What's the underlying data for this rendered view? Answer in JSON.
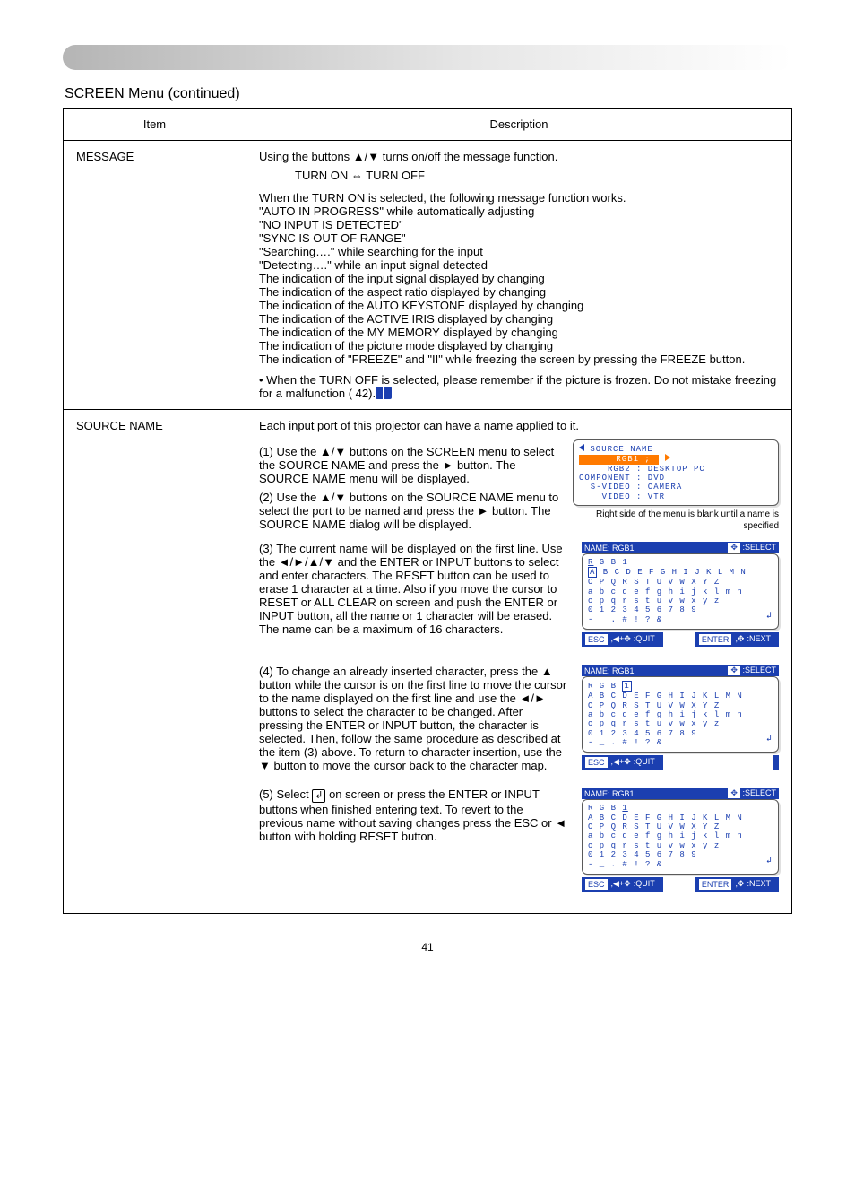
{
  "page": {
    "number": "41",
    "section_title": "SCREEN Menu (continued)"
  },
  "table": {
    "header": {
      "item": "Item",
      "desc": "Description"
    },
    "rows": [
      {
        "item": "MESSAGE",
        "desc": {
          "intro": "Using the buttons ▲/▼ turns on/off the message function.",
          "toggle_line_prefix": "TURN ON ",
          "toggle_line_suffix": " TURN OFF",
          "on_intro": "When the TURN ON is selected, the following message function works.",
          "bullets": [
            "\"AUTO IN PROGRESS\" while automatically adjusting",
            "\"NO INPUT IS DETECTED\"",
            "\"SYNC IS OUT OF RANGE\"",
            "\"Searching….\" while searching for the input",
            "\"Detecting….\" while an input signal detected",
            "The indication of the input signal displayed by changing",
            "The indication of the aspect ratio displayed by changing",
            "The indication of the AUTO KEYSTONE displayed by changing",
            "The indication of the ACTIVE IRIS displayed by changing",
            "The indication of the MY MEMORY displayed by changing",
            "The indication of the picture mode displayed by changing",
            "The indication of \"FREEZE\" and \"II\" while freezing the screen by pressing the FREEZE button."
          ],
          "note": "• When the TURN OFF is selected, please remember if the picture is frozen. Do not mistake freezing for a malfunction (   42)."
        }
      },
      {
        "item": "SOURCE NAME",
        "desc": {
          "intro": "Each input port of this projector can have a name applied to it.",
          "step1_a": "(1) Use the ▲/▼ buttons on the SCREEN menu to select the SOURCE NAME and press the ► button. The SOURCE NAME menu will be displayed.",
          "step2": "(2) Use the ▲/▼ buttons on the SOURCE NAME menu to select the port to be named and press the ► button. The SOURCE NAME dialog will be displayed.",
          "right_caption": "Right side of the menu is blank until a name is specified",
          "step3": "(3) The current name will be displayed on the first line. Use the ◄/►/▲/▼ and the ENTER or INPUT buttons to select and enter characters. The RESET button can be used to erase 1 character at a time. Also if you move the cursor to RESET or ALL CLEAR on screen and push the ENTER or INPUT button, all the name or 1 character will be erased. The name can be a maximum of 16 characters.",
          "step4": "(4) To change an already inserted character, press the ▲ button while the cursor is on the first line to move the cursor to the name displayed on the first line and use the ◄/► buttons to select the character to be changed. After pressing the ENTER or INPUT button, the character is selected. Then, follow the same procedure as described at the item (3) above. To return to character insertion, use the ▼ button to move the cursor back to the character map.",
          "step5": "(5) Select    on screen or press the ENTER or INPUT buttons when finished entering text. To revert to the previous name without saving changes press the ESC or ◄ button with holding RESET button."
        },
        "menu": {
          "title": "SOURCE NAME",
          "rows": [
            {
              "k": "RGB1",
              "v": ";",
              "active": true
            },
            {
              "k": "RGB2",
              "v": ": DESKTOP PC"
            },
            {
              "k": "COMPONENT",
              "v": ": DVD"
            },
            {
              "k": "S-VIDEO",
              "v": ": CAMERA"
            },
            {
              "k": "VIDEO",
              "v": ": VTR"
            }
          ]
        },
        "dialog_title": "NAME: RGB1",
        "select_label": ":SELECT",
        "namecurrent": "R G B 1",
        "charmap": [
          "A B C D E F G H I J K L M N",
          "O P Q R S T U V W X Y Z",
          "a b c d e f g h i j k l m n",
          "o p q r s t u v w x y z",
          "0 1 2 3 4 5 6 7 8 9",
          "- _ . # ! ? &"
        ],
        "footerL": ":QUIT",
        "footerR": ":NEXT",
        "esc": "ESC",
        "enter": "ENTER"
      }
    ]
  }
}
